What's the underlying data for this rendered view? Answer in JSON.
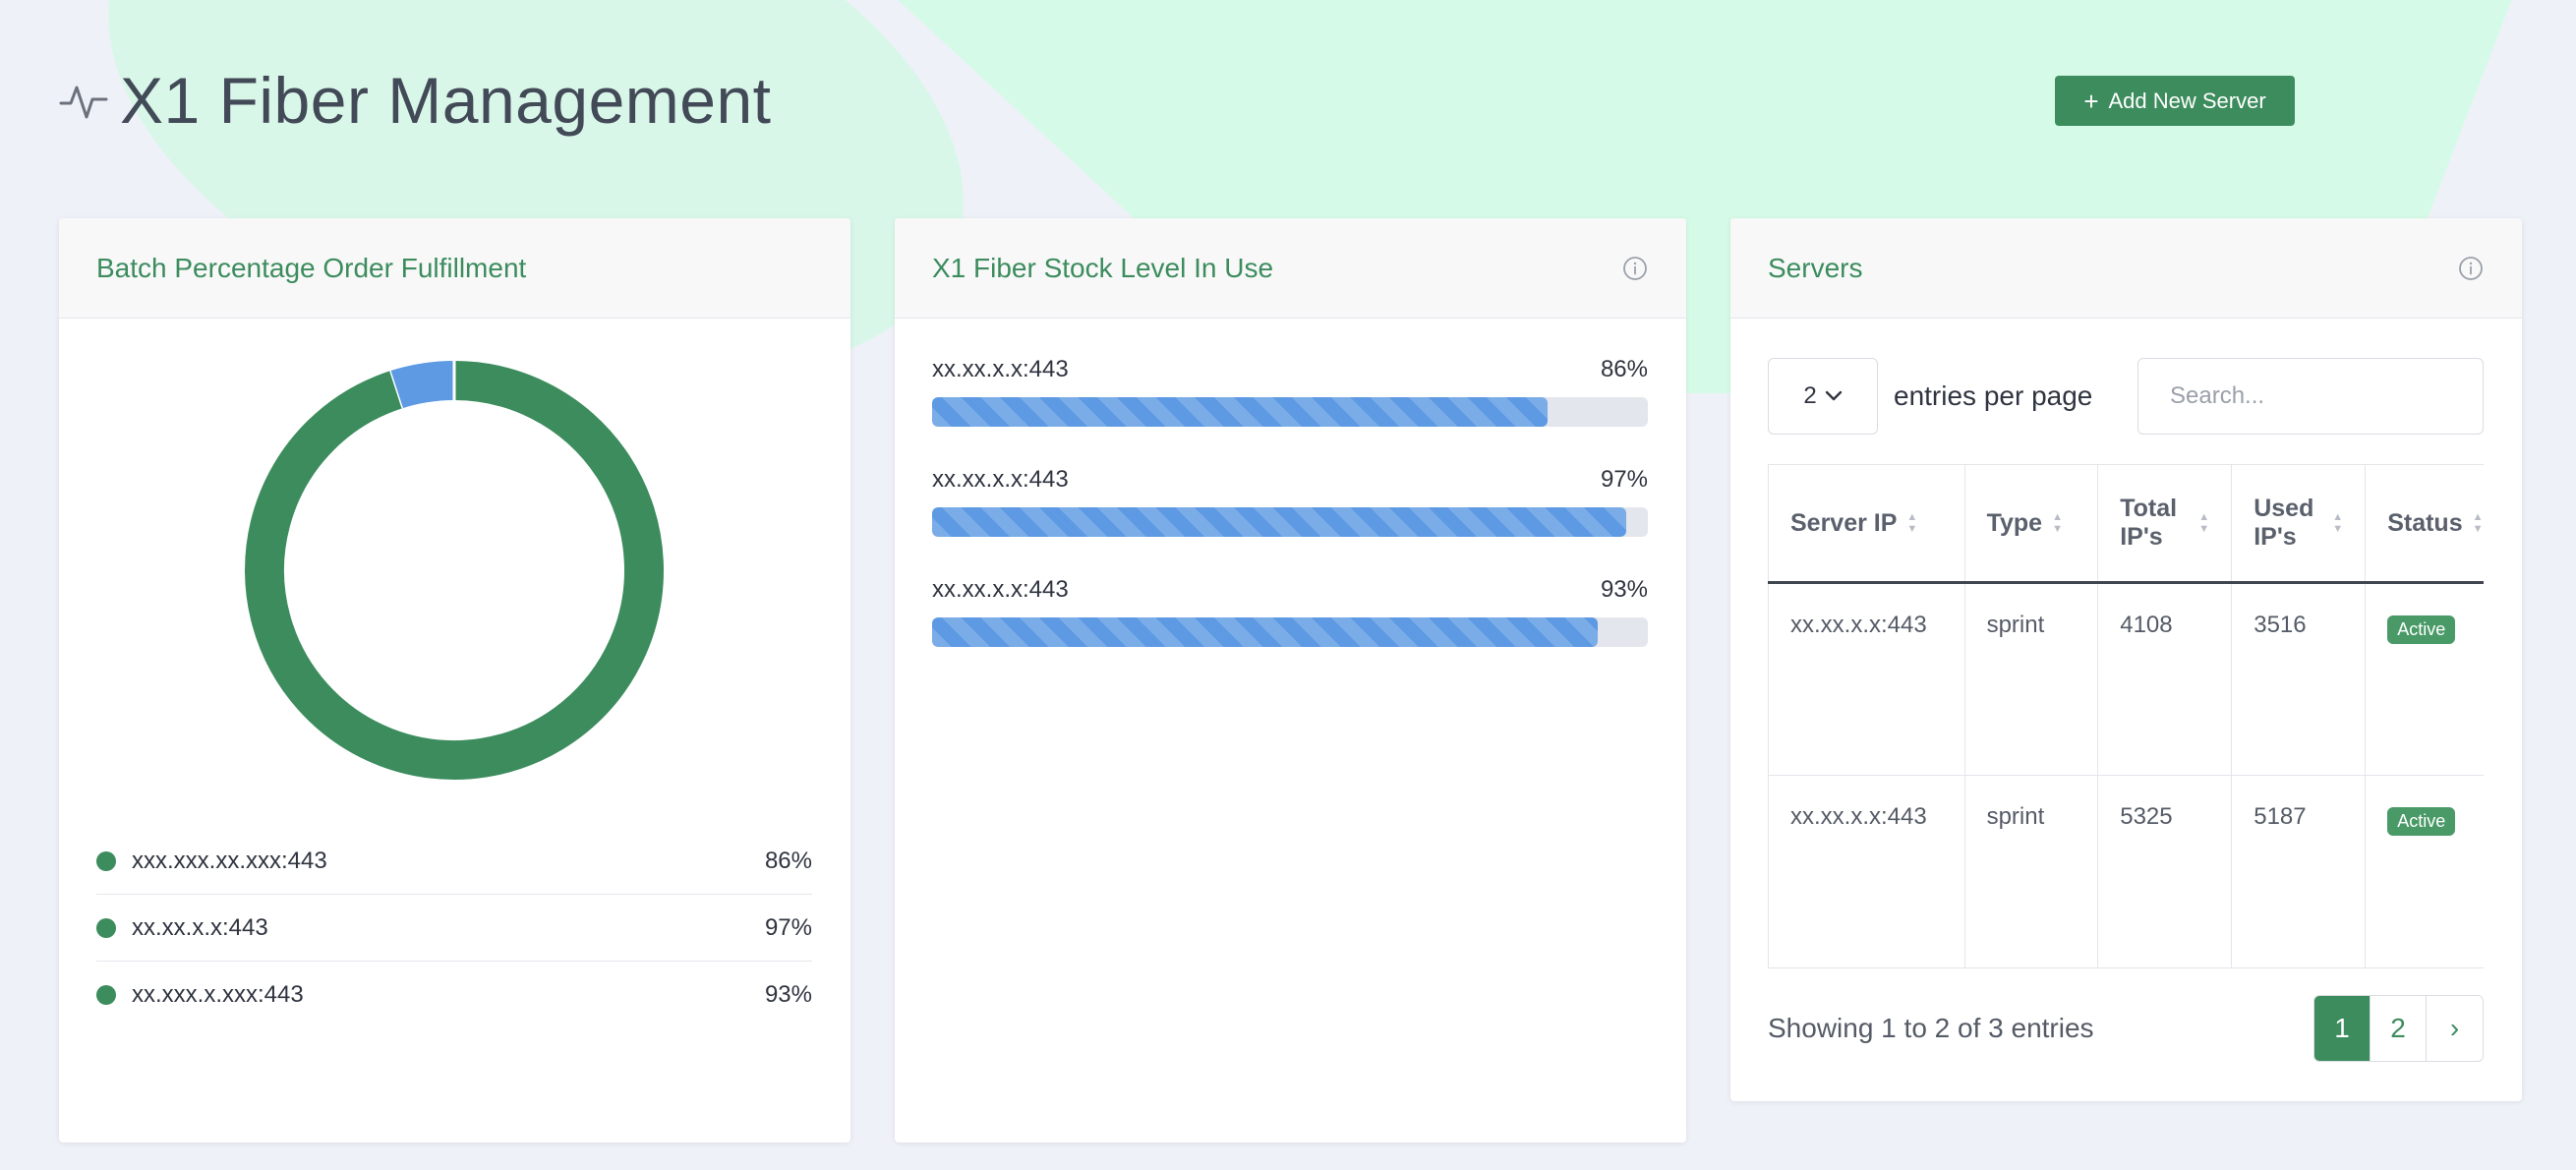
{
  "header": {
    "title": "X1 Fiber Management",
    "add_button_label": "Add New Server"
  },
  "colors": {
    "accent": "#3c8c5d",
    "chart_blue": "#5d9ae3",
    "chart_green": "#3c8c5d"
  },
  "fulfillment_card": {
    "title": "Batch Percentage Order Fulfillment",
    "legend": [
      {
        "label": "xxx.xxx.xx.xxx:443",
        "value": "86%"
      },
      {
        "label": "xx.xx.x.x:443",
        "value": "97%"
      },
      {
        "label": "xx.xxx.x.xxx:443",
        "value": "93%"
      }
    ]
  },
  "chart_data": {
    "type": "pie",
    "categories": [
      "",
      ""
    ],
    "values": [
      95,
      5
    ],
    "colors": [
      "#3c8c5d",
      "#5d9ae3"
    ]
  },
  "stock_card": {
    "title": "X1 Fiber Stock Level In Use",
    "bars": [
      {
        "label": "xx.xx.x.x:443",
        "value_text": "86%",
        "value": 86
      },
      {
        "label": "xx.xx.x.x:443",
        "value_text": "97%",
        "value": 97
      },
      {
        "label": "xx.xx.x.x:443",
        "value_text": "93%",
        "value": 93
      }
    ]
  },
  "servers_card": {
    "title": "Servers",
    "per_page_value": "2",
    "per_page_text": "entries per page",
    "search_placeholder": "Search...",
    "columns": [
      "Server IP",
      "Type",
      "Total IP's",
      "Used IP's",
      "Status"
    ],
    "rows": [
      {
        "ip": "xx.xx.x.x:443",
        "type": "sprint",
        "total": "4108",
        "used": "3516",
        "status": "Active"
      },
      {
        "ip": "xx.xx.x.x:443",
        "type": "sprint",
        "total": "5325",
        "used": "5187",
        "status": "Active"
      }
    ],
    "showing_text": "Showing 1 to 2 of 3 entries",
    "pages": [
      "1",
      "2"
    ],
    "next_label": "›"
  }
}
